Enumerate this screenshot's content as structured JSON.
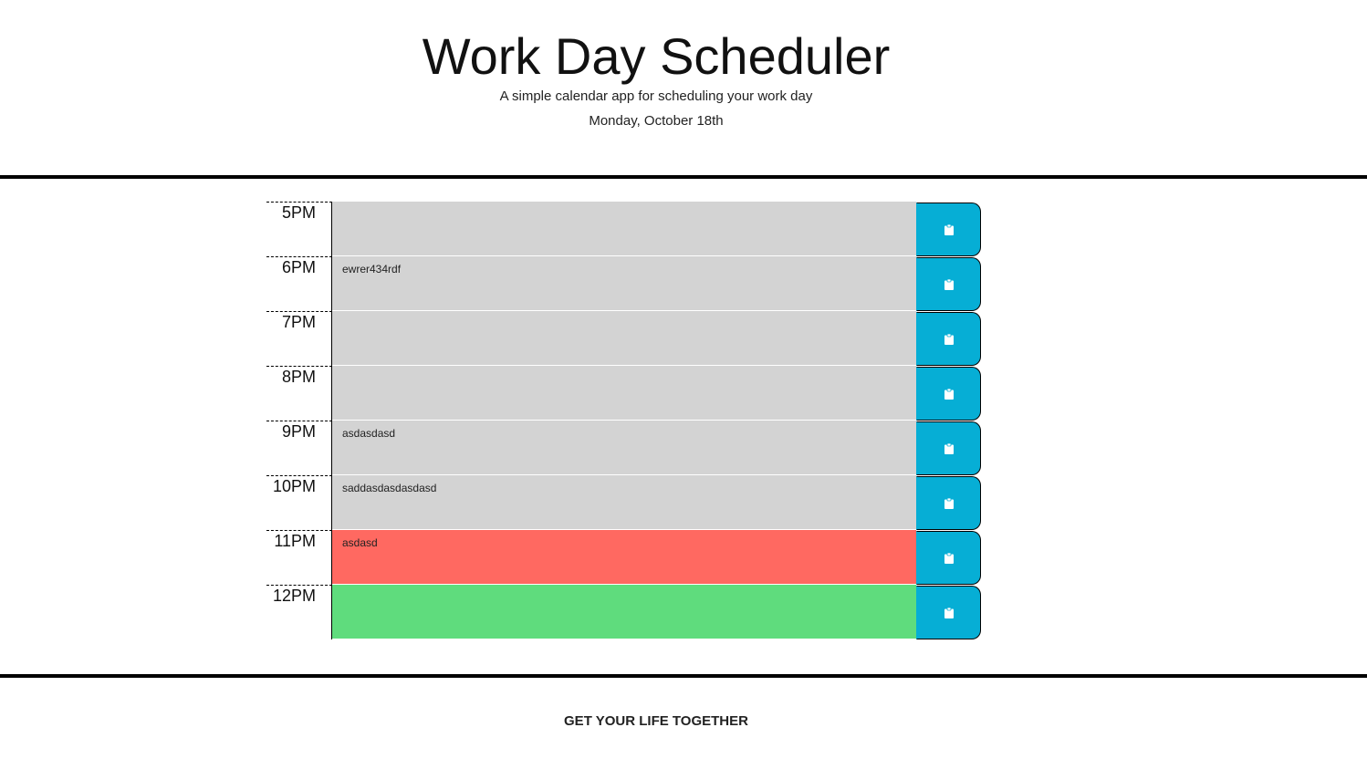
{
  "header": {
    "title": "Work Day Scheduler",
    "lead": "A simple calendar app for scheduling your work day",
    "current_day": "Monday, October 18th"
  },
  "colors": {
    "past": "#d3d3d3",
    "present": "#ff6961",
    "future": "#5fdc7d",
    "save_button": "#06aed5"
  },
  "schedule": [
    {
      "hour": "5PM",
      "text": "",
      "state": "past",
      "save_icon": "clipboard-icon"
    },
    {
      "hour": "6PM",
      "text": "ewrer434rdf",
      "state": "past",
      "save_icon": "clipboard-icon"
    },
    {
      "hour": "7PM",
      "text": "",
      "state": "past",
      "save_icon": "clipboard-icon"
    },
    {
      "hour": "8PM",
      "text": "",
      "state": "past",
      "save_icon": "clipboard-icon"
    },
    {
      "hour": "9PM",
      "text": "asdasdasd",
      "state": "past",
      "save_icon": "clipboard-icon"
    },
    {
      "hour": "10PM",
      "text": "saddasdasdasdasd",
      "state": "past",
      "save_icon": "clipboard-icon"
    },
    {
      "hour": "11PM",
      "text": "asdasd",
      "state": "present",
      "save_icon": "clipboard-icon"
    },
    {
      "hour": "12PM",
      "text": "",
      "state": "future",
      "save_icon": "clipboard-icon"
    }
  ],
  "footer": {
    "text": "GET YOUR LIFE TOGETHER"
  }
}
